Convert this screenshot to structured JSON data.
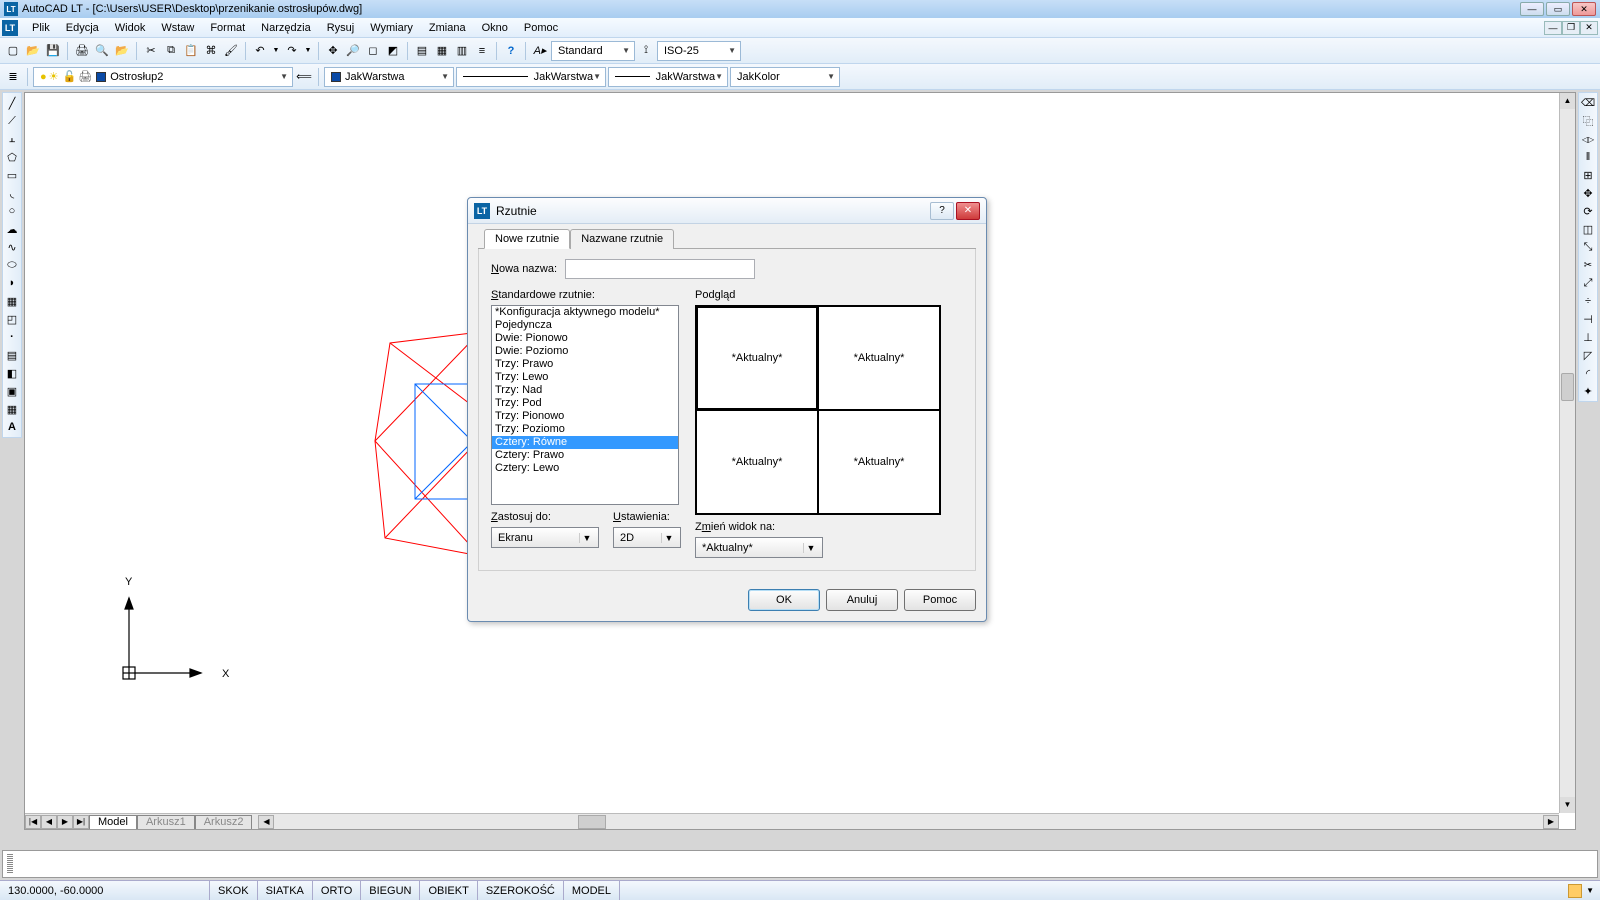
{
  "window": {
    "title": "AutoCAD LT - [C:\\Users\\USER\\Desktop\\przenikanie ostrosłupów.dwg]"
  },
  "menu": [
    "Plik",
    "Edycja",
    "Widok",
    "Wstaw",
    "Format",
    "Narzędzia",
    "Rysuj",
    "Wymiary",
    "Zmiana",
    "Okno",
    "Pomoc"
  ],
  "toolbar1": {
    "text_style": "Standard",
    "dim_style": "ISO-25"
  },
  "toolbar2": {
    "layer_name": "Ostrosłup2",
    "layer_combo1": "JakWarstwa",
    "layer_combo2": "JakWarstwa",
    "layer_combo3": "JakWarstwa",
    "color_combo": "JakKolor"
  },
  "tabs": {
    "model": "Model",
    "sheet1": "Arkusz1",
    "sheet2": "Arkusz2"
  },
  "status": {
    "coords": "130.0000,  -60.0000",
    "toggles": [
      "SKOK",
      "SIATKA",
      "ORTO",
      "BIEGUN",
      "OBIEKT",
      "SZEROKOŚĆ",
      "MODEL"
    ]
  },
  "dialog": {
    "title": "Rzutnie",
    "tab_new": "Nowe rzutnie",
    "tab_named": "Nazwane rzutnie",
    "lbl_newname": "Nowa nazwa:",
    "lbl_std": "Standardowe rzutnie:",
    "lbl_preview": "Podgląd",
    "list": [
      "*Konfiguracja aktywnego modelu*",
      "Pojedyncza",
      "Dwie: Pionowo",
      "Dwie: Poziomo",
      "Trzy: Prawo",
      "Trzy: Lewo",
      "Trzy: Nad",
      "Trzy: Pod",
      "Trzy: Pionowo",
      "Trzy: Poziomo",
      "Cztery: Równe",
      "Cztery: Prawo",
      "Cztery: Lewo"
    ],
    "selected_index": 10,
    "preview_label": "*Aktualny*",
    "lbl_apply": "Zastosuj do:",
    "apply_val": "Ekranu",
    "lbl_setup": "Ustawienia:",
    "setup_val": "2D",
    "lbl_change": "Zmień widok na:",
    "change_val": "*Aktualny*",
    "btn_ok": "OK",
    "btn_cancel": "Anuluj",
    "btn_help": "Pomoc"
  },
  "ucs": {
    "x": "X",
    "y": "Y"
  }
}
